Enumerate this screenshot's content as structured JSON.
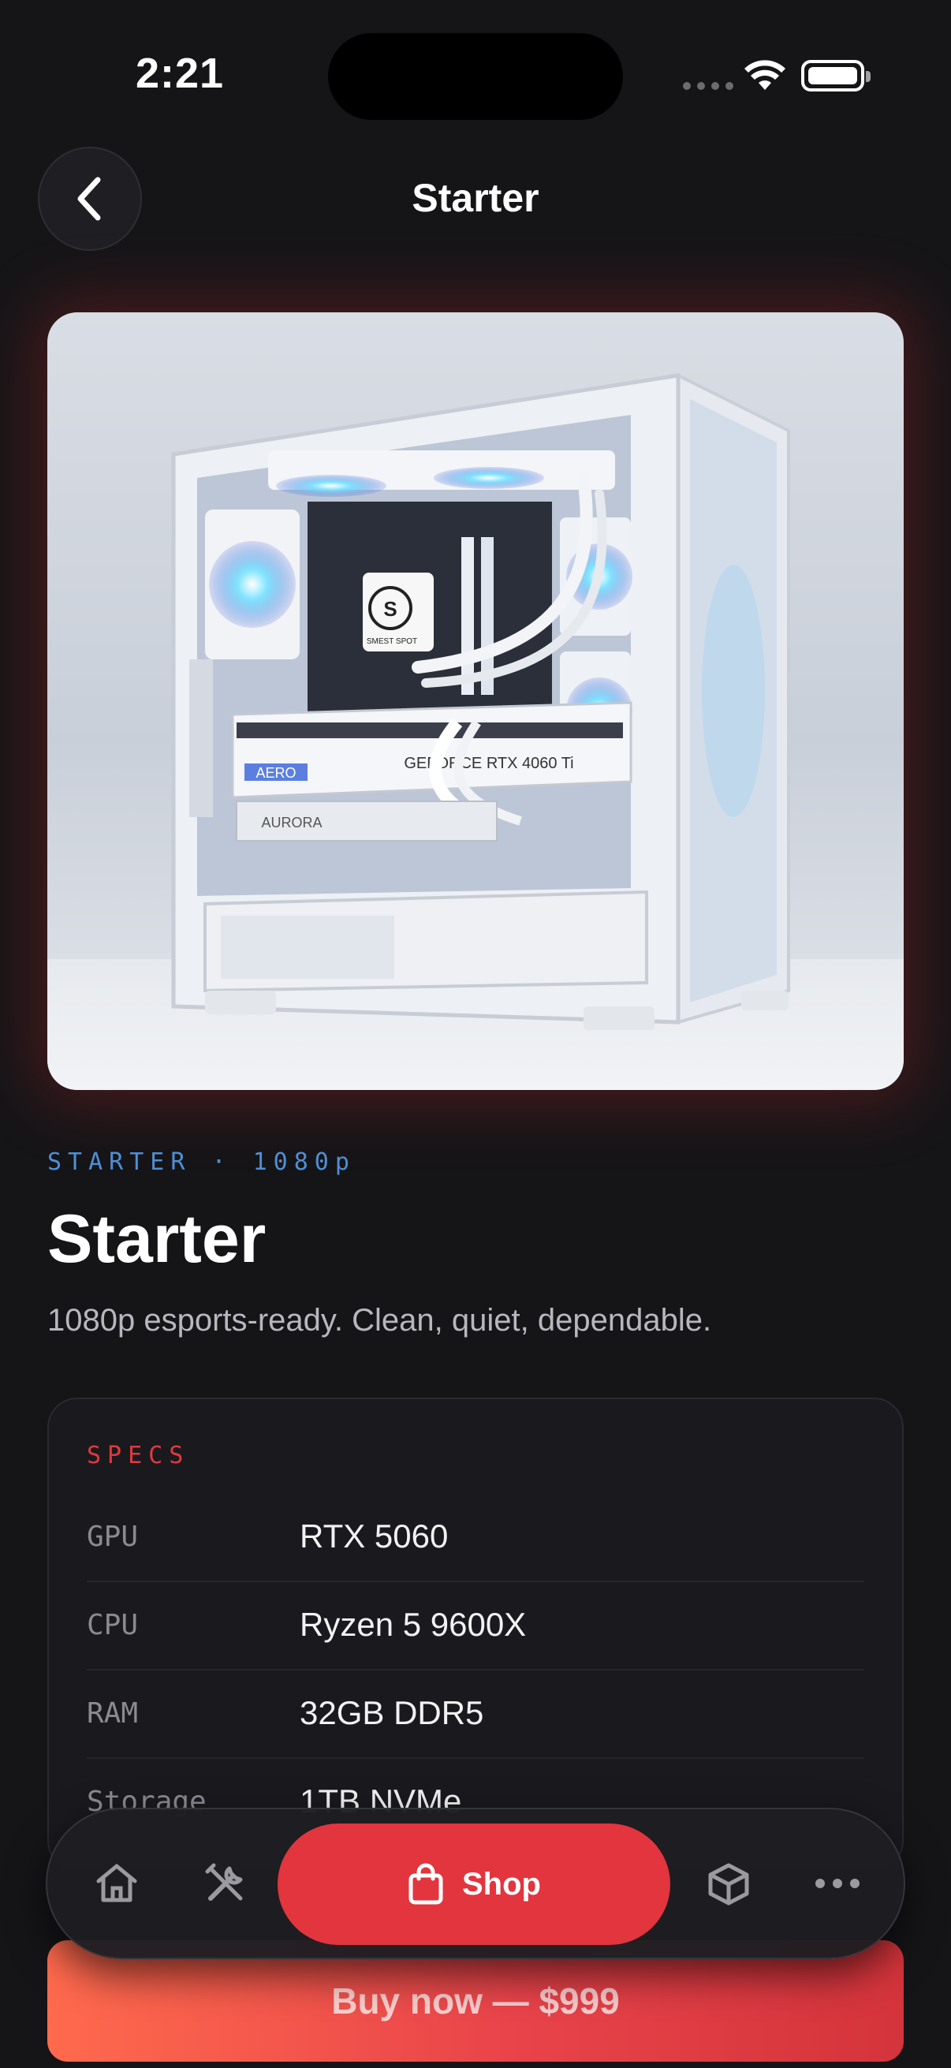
{
  "status_bar": {
    "time": "2:21"
  },
  "header": {
    "title": "Starter"
  },
  "hero": {
    "image_alt": "White PC case with RTX 4060 Ti and RGB fans",
    "logo_text": "SMEST SPOT",
    "gpu_label": "GEFORCE RTX 4060 Ti",
    "aero_label": "AERO",
    "ram_label": "AURORA"
  },
  "product": {
    "eyebrow": "STARTER · 1080p",
    "name": "Starter",
    "tagline": "1080p esports-ready. Clean, quiet, dependable."
  },
  "specs": {
    "heading": "SPECS",
    "rows": [
      {
        "label": "GPU",
        "value": "RTX 5060"
      },
      {
        "label": "CPU",
        "value": "Ryzen 5 9600X"
      },
      {
        "label": "RAM",
        "value": "32GB DDR5"
      },
      {
        "label": "Storage",
        "value": "1TB NVMe"
      }
    ]
  },
  "tabbar": {
    "shop_label": "Shop"
  },
  "buy": {
    "label": "Buy now — $999"
  },
  "colors": {
    "accent": "#e2353d",
    "eyebrow": "#4f8fd6",
    "background": "#151518"
  }
}
